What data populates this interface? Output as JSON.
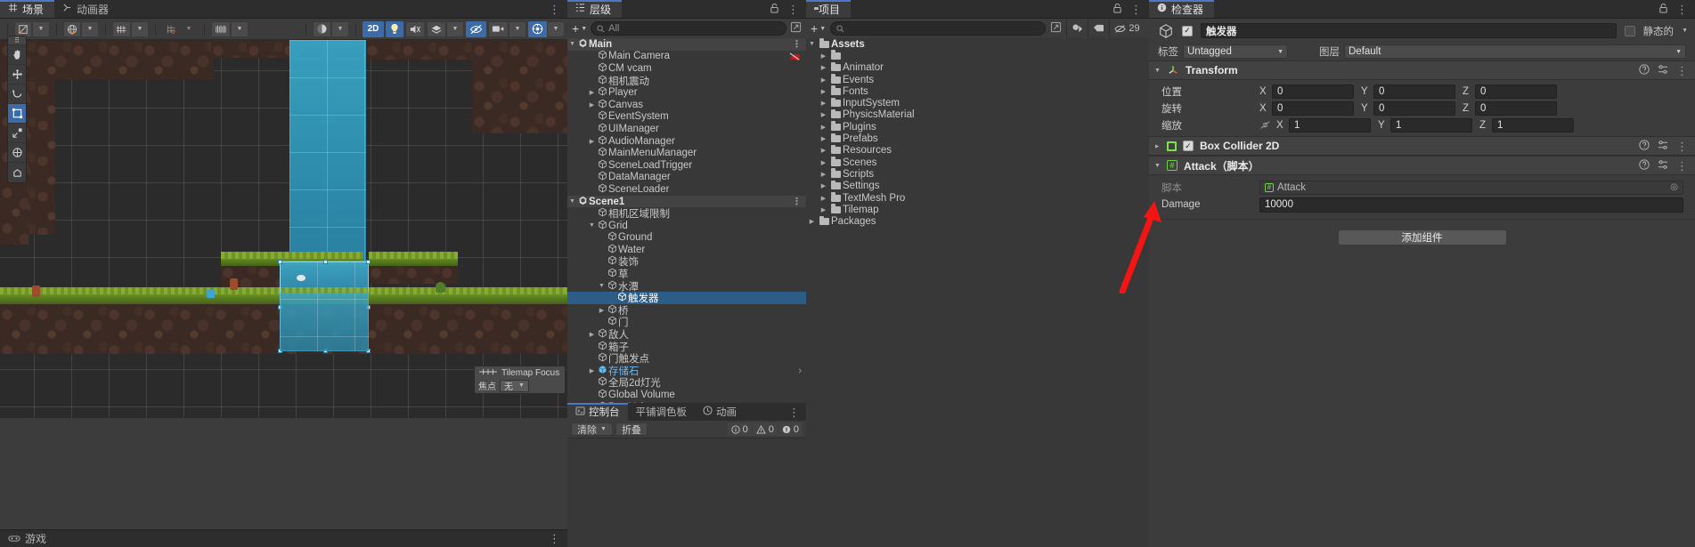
{
  "scene_panel": {
    "tabs": [
      {
        "label": "场景",
        "icon": "grid-icon",
        "active": true
      },
      {
        "label": "动画器",
        "icon": "animator-icon",
        "active": false
      }
    ],
    "toolbar": {
      "shading_label": "",
      "mode_2d": "2D",
      "buttons": [
        "pivot-toggle",
        "global-toggle",
        "grid-toggle",
        "snap-toggle",
        "layers-toggle",
        "lighting-toggle",
        "audio-toggle",
        "fx-toggle",
        "hidden-toggle",
        "camera-toggle",
        "gizmos-toggle"
      ]
    },
    "tools": [
      "hand-tool",
      "move-tool",
      "rotate-tool",
      "scale-tool",
      "rect-tool",
      "transform-tool",
      "custom-tool"
    ],
    "tilemap_focus": {
      "title": "Tilemap Focus",
      "row_label": "焦点",
      "selected": "无"
    },
    "game_tab": "游戏"
  },
  "hierarchy": {
    "tab_label": "层级",
    "search_placeholder": "All",
    "add_label": "+",
    "items": [
      {
        "label": "Main",
        "depth": 0,
        "type": "scene",
        "expanded": true
      },
      {
        "label": "Main Camera",
        "depth": 2,
        "type": "object",
        "badge": "camera-off-icon"
      },
      {
        "label": "CM vcam",
        "depth": 2,
        "type": "object"
      },
      {
        "label": "相机震动",
        "depth": 2,
        "type": "object"
      },
      {
        "label": "Player",
        "depth": 2,
        "type": "object",
        "arrow": true
      },
      {
        "label": "Canvas",
        "depth": 2,
        "type": "object",
        "arrow": true
      },
      {
        "label": "EventSystem",
        "depth": 2,
        "type": "object"
      },
      {
        "label": "UIManager",
        "depth": 2,
        "type": "object"
      },
      {
        "label": "AudioManager",
        "depth": 2,
        "type": "object",
        "arrow": true
      },
      {
        "label": "MainMenuManager",
        "depth": 2,
        "type": "object"
      },
      {
        "label": "SceneLoadTrigger",
        "depth": 2,
        "type": "object"
      },
      {
        "label": "DataManager",
        "depth": 2,
        "type": "object"
      },
      {
        "label": "SceneLoader",
        "depth": 2,
        "type": "object"
      },
      {
        "label": "Scene1",
        "depth": 0,
        "type": "scene",
        "expanded": true
      },
      {
        "label": "相机区域限制",
        "depth": 2,
        "type": "object"
      },
      {
        "label": "Grid",
        "depth": 2,
        "type": "object",
        "expanded": true
      },
      {
        "label": "Ground",
        "depth": 3,
        "type": "object"
      },
      {
        "label": "Water",
        "depth": 3,
        "type": "object"
      },
      {
        "label": "装饰",
        "depth": 3,
        "type": "object"
      },
      {
        "label": "草",
        "depth": 3,
        "type": "object"
      },
      {
        "label": "水潭",
        "depth": 3,
        "type": "object",
        "expanded": true
      },
      {
        "label": "触发器",
        "depth": 4,
        "type": "object",
        "selected": true
      },
      {
        "label": "桥",
        "depth": 3,
        "type": "object",
        "arrow": true
      },
      {
        "label": "门",
        "depth": 3,
        "type": "object"
      },
      {
        "label": "敌人",
        "depth": 2,
        "type": "object",
        "arrow": true
      },
      {
        "label": "箱子",
        "depth": 2,
        "type": "object"
      },
      {
        "label": "门触发点",
        "depth": 2,
        "type": "object"
      },
      {
        "label": "存储石",
        "depth": 2,
        "type": "prefab",
        "arrow": true,
        "more": true
      },
      {
        "label": "全局2d灯光",
        "depth": 2,
        "type": "object"
      },
      {
        "label": "Global Volume",
        "depth": 2,
        "type": "object"
      },
      {
        "label": "Box Volume",
        "depth": 2,
        "type": "object"
      }
    ]
  },
  "console": {
    "tabs": [
      {
        "label": "控制台",
        "icon": "console-icon",
        "active": true
      },
      {
        "label": "平铺调色板",
        "icon": "palette-icon",
        "active": false
      },
      {
        "label": "动画",
        "icon": "animation-icon",
        "active": false
      }
    ],
    "clear_label": "清除",
    "collapse_label": "折叠",
    "counts": {
      "info": "0",
      "warning": "0",
      "error": "0"
    }
  },
  "project": {
    "tab_label": "项目",
    "search_placeholder": "",
    "add_label": "+",
    "items": [
      {
        "label": "Assets",
        "depth": 0,
        "expanded": true,
        "root": true
      },
      {
        "label": "",
        "depth": 1
      },
      {
        "label": "Animator",
        "depth": 1
      },
      {
        "label": "Events",
        "depth": 1
      },
      {
        "label": "Fonts",
        "depth": 1
      },
      {
        "label": "InputSystem",
        "depth": 1
      },
      {
        "label": "PhysicsMaterial",
        "depth": 1
      },
      {
        "label": "Plugins",
        "depth": 1
      },
      {
        "label": "Prefabs",
        "depth": 1
      },
      {
        "label": "Resources",
        "depth": 1
      },
      {
        "label": "Scenes",
        "depth": 1
      },
      {
        "label": "Scripts",
        "depth": 1
      },
      {
        "label": "Settings",
        "depth": 1
      },
      {
        "label": "TextMesh Pro",
        "depth": 1
      },
      {
        "label": "Tilemap",
        "depth": 1
      },
      {
        "label": "Packages",
        "depth": 0
      }
    ],
    "hidden_count": "29"
  },
  "inspector": {
    "tab_label": "检查器",
    "object_name": "触发器",
    "enabled": true,
    "static_label": "静态的",
    "tag_label": "标签",
    "tag_value": "Untagged",
    "layer_label": "图层",
    "layer_value": "Default",
    "components": [
      {
        "title": "Transform",
        "icon": "transform-icon",
        "expanded": true,
        "rows": [
          {
            "label": "位置",
            "x": "0",
            "y": "0",
            "z": "0"
          },
          {
            "label": "旋转",
            "x": "0",
            "y": "0",
            "z": "0"
          },
          {
            "label": "缩放",
            "x": "1",
            "y": "1",
            "z": "1",
            "link_icon": "constrain-off-icon"
          }
        ]
      },
      {
        "title": "Box Collider 2D",
        "icon": "box-collider-2d-icon",
        "expanded": false,
        "enabled": true
      },
      {
        "title": "Attack（脚本）",
        "icon": "script-icon",
        "expanded": true,
        "fields": [
          {
            "label": "脚本",
            "value": "Attack",
            "type": "object"
          },
          {
            "label": "Damage",
            "value": "10000",
            "type": "number"
          }
        ]
      }
    ],
    "add_component_label": "添加组件",
    "axis_labels": {
      "x": "X",
      "y": "Y",
      "z": "Z"
    }
  }
}
